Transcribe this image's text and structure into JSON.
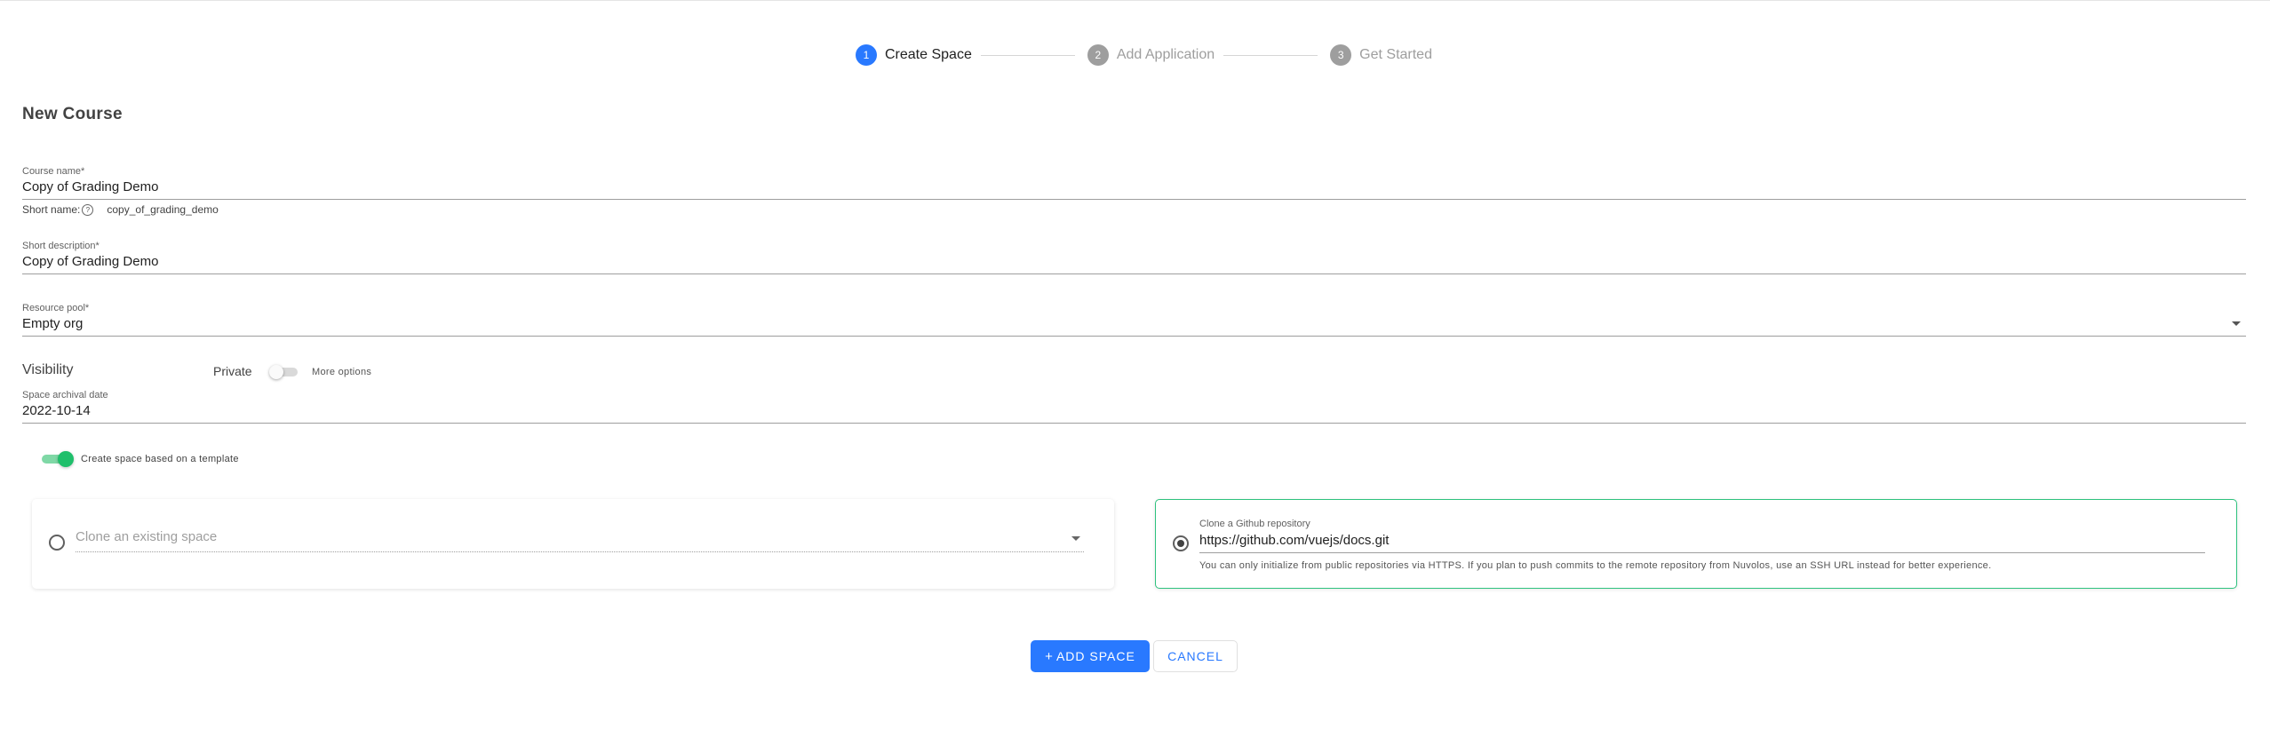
{
  "stepper": {
    "steps": [
      {
        "number": "1",
        "label": "Create Space",
        "active": true
      },
      {
        "number": "2",
        "label": "Add Application",
        "active": false
      },
      {
        "number": "3",
        "label": "Get Started",
        "active": false
      }
    ]
  },
  "form": {
    "title": "New Course",
    "course_name": {
      "label": "Course name*",
      "value": "Copy of Grading Demo"
    },
    "short_name": {
      "label": "Short name:",
      "help_icon": "question-circle-icon",
      "value": "copy_of_grading_demo"
    },
    "short_description": {
      "label": "Short description*",
      "value": "Copy of Grading Demo"
    },
    "resource_pool": {
      "label": "Resource pool*",
      "value": "Empty org"
    },
    "visibility": {
      "label": "Visibility",
      "private_label": "Private",
      "private_enabled": false,
      "more_options_label": "More options"
    },
    "archival_date": {
      "label": "Space archival date",
      "value": "2022-10-14"
    },
    "template_toggle": {
      "label": "Create space based on a template",
      "enabled": true
    },
    "clone_space": {
      "placeholder": "Clone an existing space",
      "selected": false
    },
    "clone_repo": {
      "label": "Clone a Github repository",
      "value": "https://github.com/vuejs/docs.git",
      "hint": "You can only initialize from public repositories via HTTPS. If you plan to push commits to the remote repository from Nuvolos, use an SSH URL instead for better experience.",
      "selected": true
    }
  },
  "actions": {
    "add_label": "ADD SPACE",
    "add_icon": "plus-icon",
    "cancel_label": "CANCEL"
  },
  "colors": {
    "primary": "#2979ff",
    "success": "#2ec27e",
    "inactive_step": "#9e9e9e"
  }
}
